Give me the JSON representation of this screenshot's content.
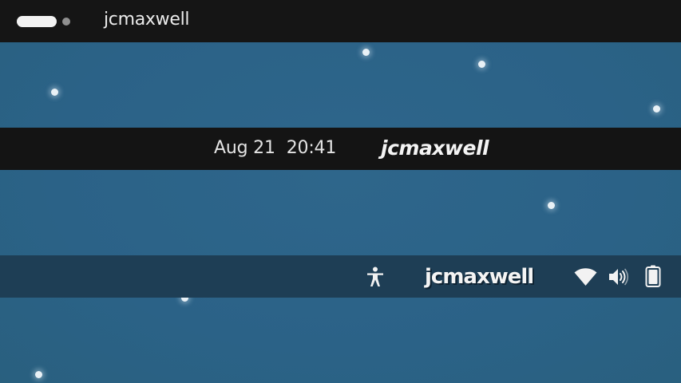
{
  "top_bar": {
    "title": "jcmaxwell"
  },
  "center_bar": {
    "date": "Aug 21",
    "time": "20:41",
    "user_label": "jcmaxwell"
  },
  "lower_bar": {
    "user_label": "jcmaxwell",
    "icons": [
      "accessibility-icon",
      "wifi-icon",
      "volume-icon",
      "battery-icon"
    ]
  },
  "colors": {
    "wallpaper": "#2c6388",
    "top_bar": "#151515",
    "center_bar": "#141414",
    "lower_bar": "#1e3e55",
    "text": "#ececec"
  }
}
